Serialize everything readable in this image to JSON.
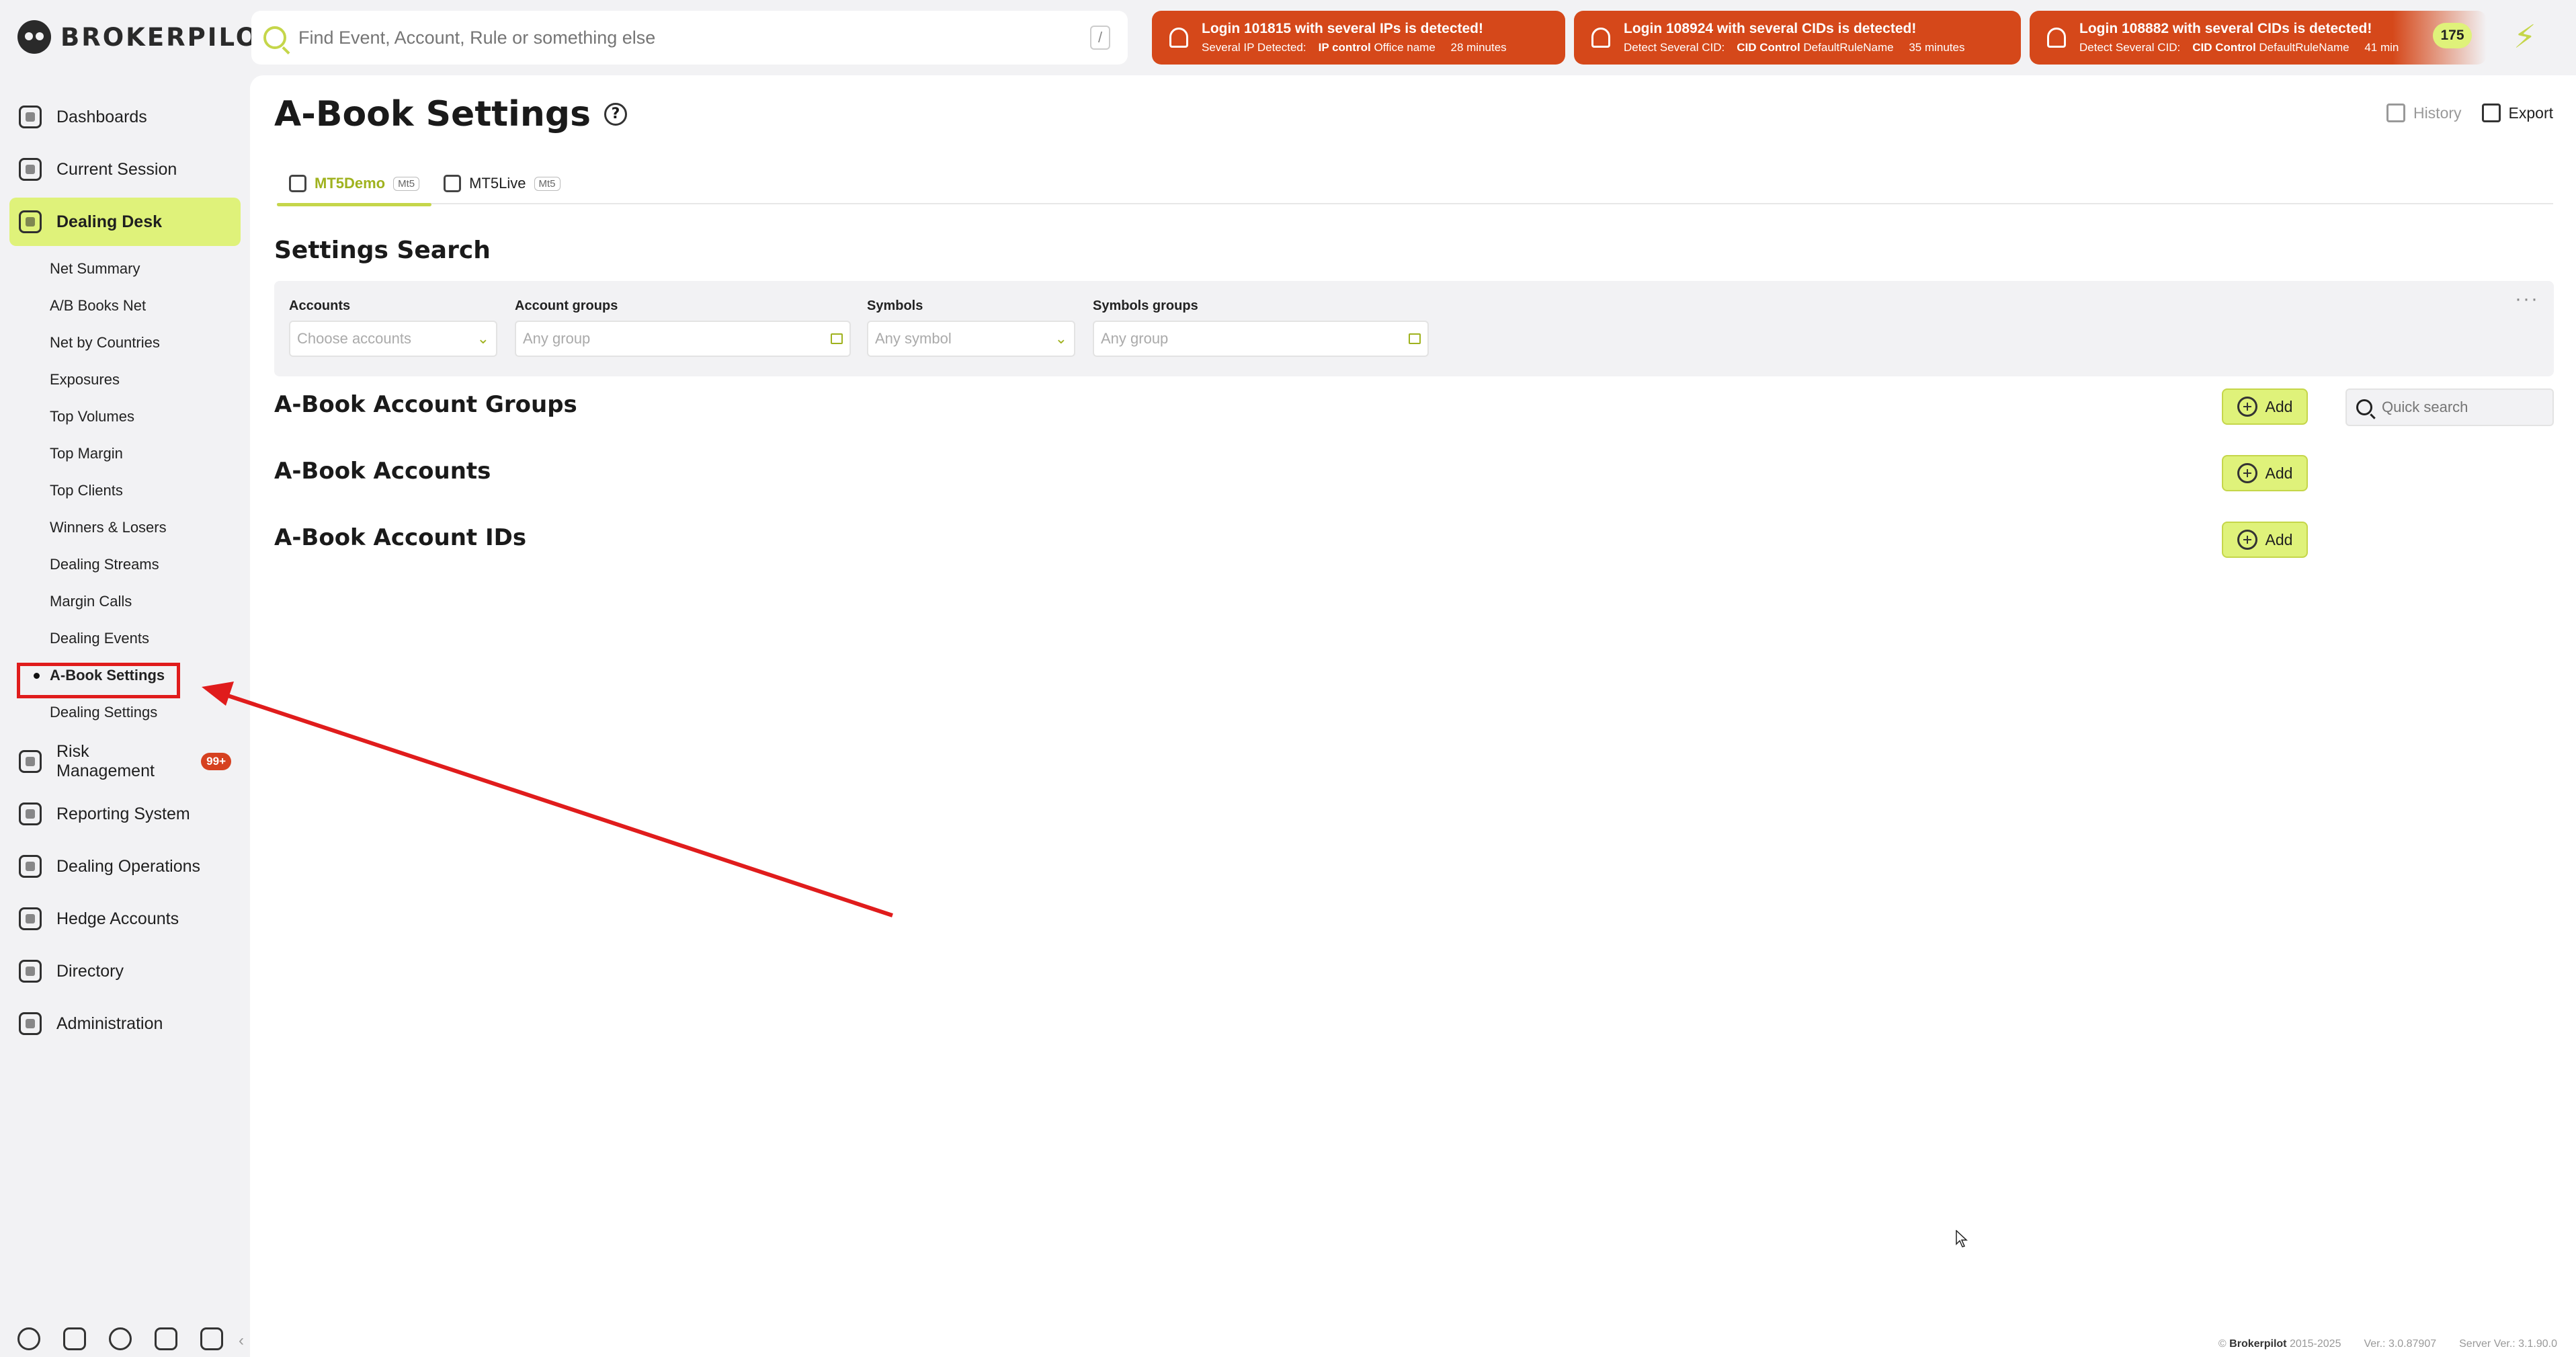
{
  "app": {
    "logo_text": "BROKERPILOT"
  },
  "search": {
    "placeholder": "Find Event, Account, Rule or something else",
    "shortcut": "/"
  },
  "alerts": [
    {
      "title": "Login 101815 with several IPs is detected!",
      "detail_label": "Several IP Detected:",
      "detail_value": "IP control",
      "rule": "Office name",
      "time": "28 minutes"
    },
    {
      "title": "Login 108924 with several CIDs is detected!",
      "detail_label": "Detect Several CID:",
      "detail_value": "CID Control",
      "rule": "DefaultRuleName",
      "time": "35 minutes"
    },
    {
      "title": "Login 108882 with several CIDs is detected!",
      "detail_label": "Detect Several CID:",
      "detail_value": "CID Control",
      "rule": "DefaultRuleName",
      "time": "41 min"
    }
  ],
  "alert_count": "175",
  "nav": {
    "dashboards": "Dashboards",
    "current_session": "Current Session",
    "dealing_desk": "Dealing Desk",
    "risk_management": "Risk Management",
    "risk_badge": "99+",
    "reporting_system": "Reporting System",
    "dealing_operations": "Dealing Operations",
    "hedge_accounts": "Hedge Accounts",
    "directory": "Directory",
    "administration": "Administration"
  },
  "subnav": [
    "Net Summary",
    "A/B Books Net",
    "Net by Countries",
    "Exposures",
    "Top Volumes",
    "Top Margin",
    "Top Clients",
    "Winners & Losers",
    "Dealing Streams",
    "Margin Calls",
    "Dealing Events",
    "A-Book Settings",
    "Dealing Settings"
  ],
  "page": {
    "title": "A-Book Settings",
    "history": "History",
    "export": "Export",
    "tabs": [
      {
        "label": "MT5Demo",
        "pill": "Mt5"
      },
      {
        "label": "MT5Live",
        "pill": "Mt5"
      }
    ],
    "settings_search": "Settings Search",
    "filters": {
      "accounts_label": "Accounts",
      "accounts_placeholder": "Choose accounts",
      "account_groups_label": "Account groups",
      "account_groups_placeholder": "Any group",
      "symbols_label": "Symbols",
      "symbols_placeholder": "Any symbol",
      "symbols_groups_label": "Symbols groups",
      "symbols_groups_placeholder": "Any group"
    },
    "sections": {
      "groups": "A-Book Account Groups",
      "accounts": "A-Book Accounts",
      "ids": "A-Book Account IDs"
    },
    "add_label": "Add",
    "quick_search_placeholder": "Quick search"
  },
  "footer": {
    "copyright_brand": "Brokerpilot",
    "copyright_years": "2015-2025",
    "version": "Ver.: 3.0.87907",
    "server_version": "Server Ver.: 3.1.90.0"
  },
  "colors": {
    "accent": "#dff27a",
    "alert": "#d5481a",
    "annotation": "#e01c1c"
  }
}
